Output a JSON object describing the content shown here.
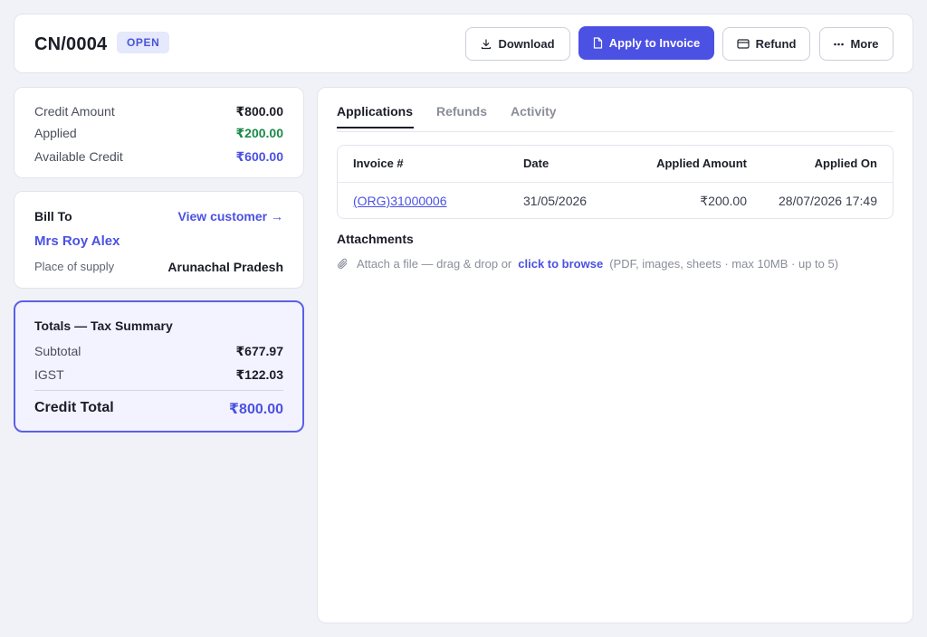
{
  "header": {
    "title": "CN/0004",
    "status": "OPEN",
    "buttons": {
      "download": "Download",
      "apply": "Apply to Invoice",
      "refund": "Refund",
      "more": "More"
    }
  },
  "summary": {
    "credit_amount_label": "Credit Amount",
    "credit_amount_value": "₹800.00",
    "applied_label": "Applied",
    "applied_value": "₹200.00",
    "available_label": "Available Credit",
    "available_value": "₹600.00"
  },
  "bill_to": {
    "label": "Bill To",
    "view_customer": "View customer →",
    "customer_name": "Mrs Roy Alex",
    "place_of_supply_label": "Place of supply",
    "place_of_supply_value": "Arunachal Pradesh"
  },
  "totals": {
    "title": "Totals — Tax Summary",
    "subtotal_label": "Subtotal",
    "subtotal_value": "₹677.97",
    "igst_label": "IGST",
    "igst_value": "₹122.03",
    "credit_total_label": "Credit Total",
    "credit_total_value": "₹800.00"
  },
  "tabs": {
    "applications": "Applications",
    "refunds": "Refunds",
    "activity": "Activity",
    "active": "Applications"
  },
  "applications_table": {
    "columns": [
      "Invoice #",
      "Date",
      "Applied Amount",
      "Applied On"
    ],
    "rows": [
      [
        "(ORG)31000006",
        "31/05/2026",
        "₹200.00",
        "28/07/2026 17:49"
      ]
    ]
  },
  "attachments": {
    "title": "Attachments",
    "prompt": "Attach a file — drag & drop or",
    "browse": "click to browse",
    "hint": "(PDF, images, sheets · max 10MB · up to 5)"
  },
  "colors": {
    "accent": "#4b51e3",
    "applied_green": "#1a8a4a",
    "status_badge_bg": "#e6e8fb"
  },
  "icons": {
    "download": "download-icon",
    "apply": "document-icon",
    "refund": "card-icon",
    "more": "more-dots-icon",
    "attach": "paperclip-icon"
  }
}
